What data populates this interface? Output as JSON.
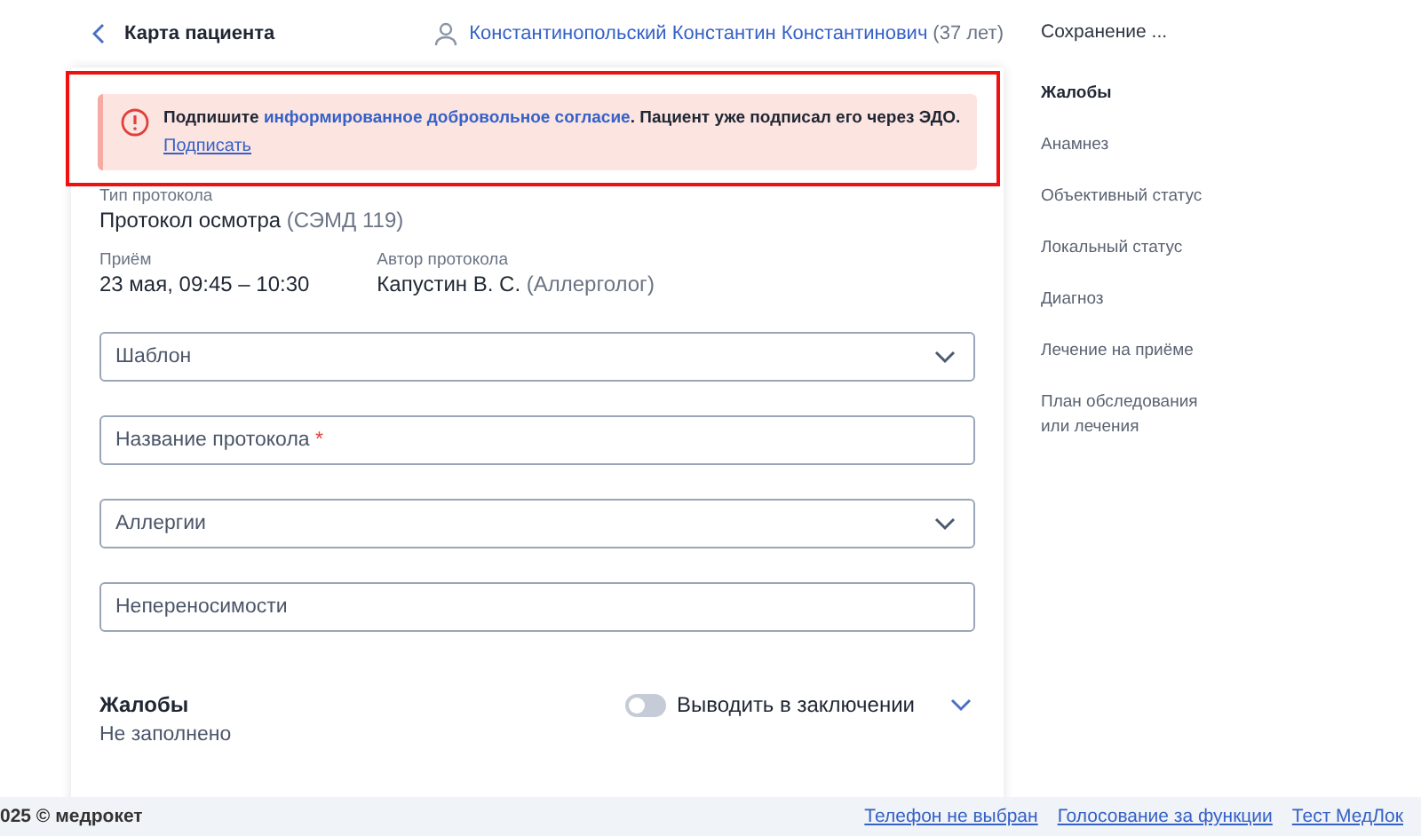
{
  "header": {
    "back_label": "Карта пациента",
    "patient_name": "Константинопольский Константин Константинович",
    "patient_age": "(37 лет)"
  },
  "alert": {
    "highlighted": true,
    "text_before": "Подпишите",
    "link": "информированное добровольное согласие",
    "text_after": ". Пациент уже подписал его через ЭДО.",
    "action": "Подписать"
  },
  "protocol_type": {
    "label": "Тип протокола",
    "value": "Протокол осмотра",
    "note": "(СЭМД 119)"
  },
  "meta": [
    {
      "label": "Приём",
      "value": "23 мая, 09:45 – 10:30"
    },
    {
      "label": "Автор протокола",
      "value": "Капустин В. С.",
      "note": "(Аллерголог)"
    }
  ],
  "fields": [
    {
      "kind": "select",
      "placeholder": "Шаблон"
    },
    {
      "kind": "input",
      "placeholder": "Название протокола",
      "required_mark": "*"
    },
    {
      "kind": "select",
      "placeholder": "Аллергии"
    },
    {
      "kind": "input",
      "placeholder": "Непереносимости"
    }
  ],
  "section": {
    "title": "Жалобы",
    "value": "Не заполнено",
    "toggle_label": "Выводить в заключении",
    "toggle_on": false,
    "expanded": false
  },
  "save_status": "Сохранение ...",
  "nav": [
    {
      "label": "Жалобы",
      "selected": true
    },
    {
      "label": "Анамнез",
      "selected": false
    },
    {
      "label": "Объективный статус",
      "selected": false
    },
    {
      "label": "Локальный статус",
      "selected": false
    },
    {
      "label": "Диагноз",
      "selected": false
    },
    {
      "label": "Лечение на приёме",
      "selected": false
    },
    {
      "label": "План обследования или лечения",
      "selected": false
    }
  ],
  "footer": {
    "copyright": "025 © медрокет",
    "links": [
      "Телефон не выбран",
      "Голосование за функции",
      "Тест МедЛок"
    ]
  }
}
